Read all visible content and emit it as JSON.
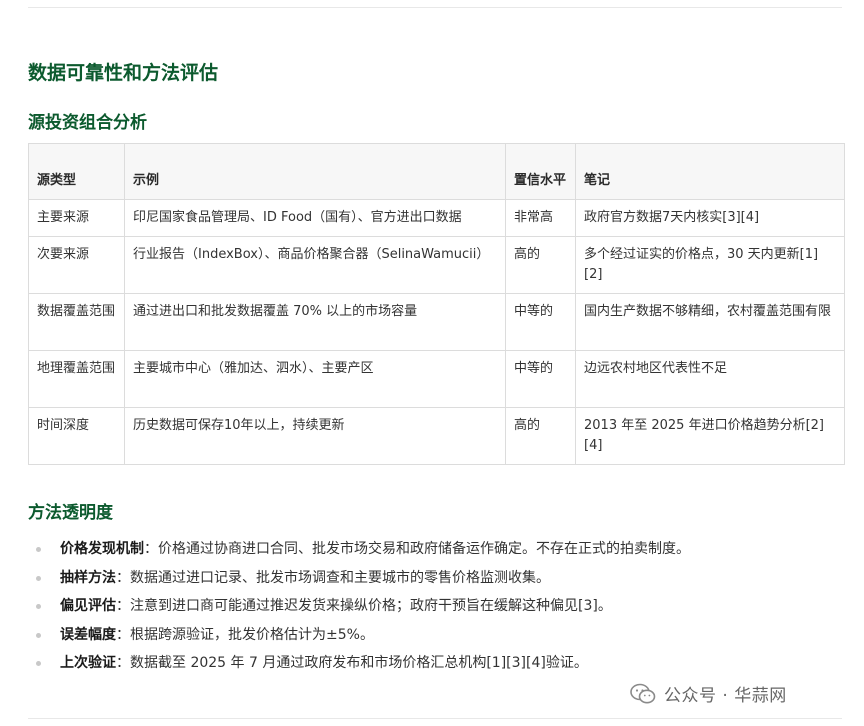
{
  "heading": "数据可靠性和方法评估",
  "subheading": "源投资组合分析",
  "table": {
    "headers": [
      "源类型",
      "示例",
      "置信水平",
      "笔记"
    ],
    "rows": [
      [
        "主要来源",
        "印尼国家食品管理局、ID Food（国有）、官方进出口数据",
        "非常高",
        "政府官方数据7天内核实[3][4]"
      ],
      [
        "次要来源",
        "行业报告（IndexBox）、商品价格聚合器（SelinaWamucii）",
        "高的",
        "多个经过证实的价格点，30 天内更新[1][2]"
      ],
      [
        "数据覆盖范围",
        "通过进出口和批发数据覆盖 70% 以上的市场容量",
        "中等的",
        "国内生产数据不够精细，农村覆盖范围有限"
      ],
      [
        "地理覆盖范围",
        "主要城市中心（雅加达、泗水）、主要产区",
        "中等的",
        "边远农村地区代表性不足"
      ],
      [
        "时间深度",
        "历史数据可保存10年以上，持续更新",
        "高的",
        "2013 年至 2025 年进口价格趋势分析[2][4]"
      ]
    ]
  },
  "methodology": {
    "title": "方法透明度",
    "items": [
      {
        "term": "价格发现机制",
        "sep": "：",
        "text": "价格通过协商进口合同、批发市场交易和政府储备运作确定。不存在正式的拍卖制度。"
      },
      {
        "term": "抽样方法",
        "sep": "：",
        "text": "数据通过进口记录、批发市场调查和主要城市的零售价格监测收集。"
      },
      {
        "term": "偏见评估",
        "sep": "：",
        "text": "注意到进口商可能通过推迟发货来操纵价格；政府干预旨在缓解这种偏见[3]。"
      },
      {
        "term": "误差幅度",
        "sep": "：",
        "text": "根据跨源验证，批发价格估计为±5%。"
      },
      {
        "term": "上次验证",
        "sep": "：",
        "text": "数据截至 2025 年 7 月通过政府发布和市场价格汇总机构[1][3][4]验证。"
      }
    ]
  },
  "watermark": {
    "icon": "wechat-icon",
    "text": "公众号 · 华蒜网"
  },
  "colors": {
    "heading": "#0c5a2e",
    "border": "#dcdcdc",
    "header_bg": "#f7f7f7"
  }
}
